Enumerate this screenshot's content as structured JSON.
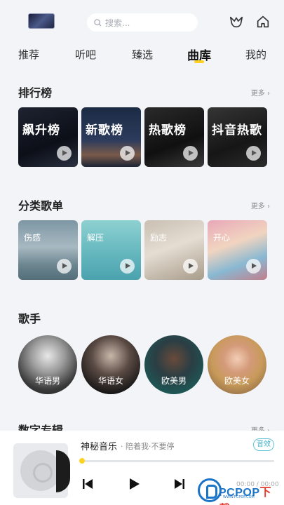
{
  "search": {
    "placeholder": "搜索..."
  },
  "tabs": [
    {
      "label": "推荐"
    },
    {
      "label": "听吧"
    },
    {
      "label": "臻选"
    },
    {
      "label": "曲库"
    },
    {
      "label": "我的"
    }
  ],
  "active_tab": "曲库",
  "charts": {
    "title": "排行榜",
    "more": "更多",
    "items": [
      {
        "label": "飙升榜"
      },
      {
        "label": "新歌榜"
      },
      {
        "label": "热歌榜"
      },
      {
        "label": "抖音热歌"
      }
    ]
  },
  "categories": {
    "title": "分类歌单",
    "more": "更多",
    "items": [
      {
        "label": "伤感"
      },
      {
        "label": "解压"
      },
      {
        "label": "励志"
      },
      {
        "label": "开心"
      }
    ]
  },
  "singers": {
    "title": "歌手",
    "items": [
      {
        "label": "华语男"
      },
      {
        "label": "华语女"
      },
      {
        "label": "欧美男"
      },
      {
        "label": "欧美女"
      }
    ]
  },
  "albums": {
    "title": "数字专辑",
    "more": "更多"
  },
  "player": {
    "song": "神秘音乐",
    "artist": "· 陪着我·不要停",
    "quality": "音效",
    "time": "00:00 / 00:00",
    "progress": 0
  },
  "watermark": {
    "brand": "PCPOP",
    "suffix": "下载",
    "sub": "WWW.PCPOP.COM"
  },
  "colors": {
    "accent": "#ffd21f",
    "quality": "#3fb0c4"
  }
}
